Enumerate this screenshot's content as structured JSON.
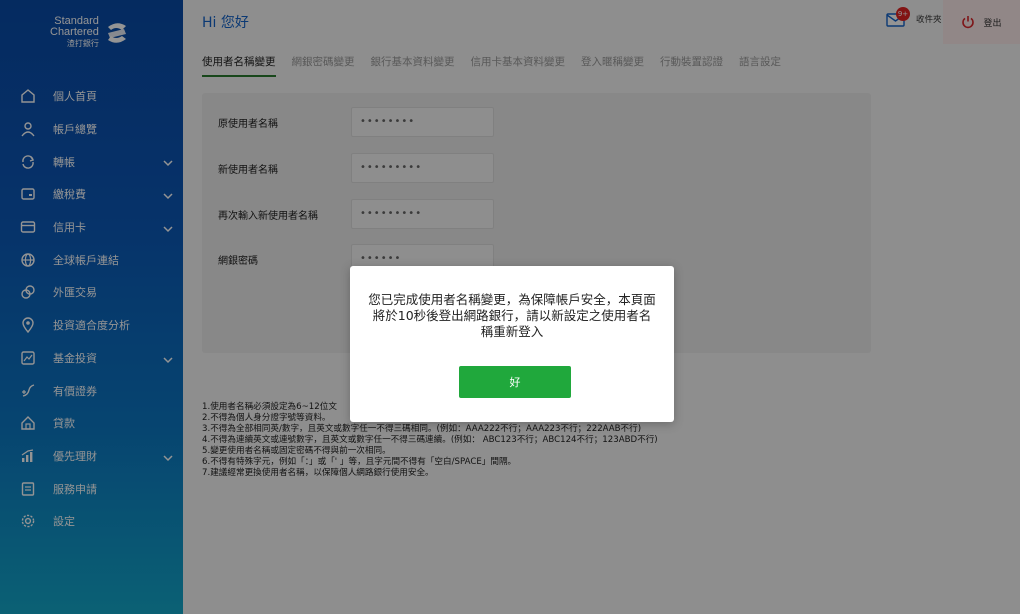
{
  "brand": {
    "line1": "Standard",
    "line2": "Chartered",
    "line3": "渣打銀行"
  },
  "sidebar": {
    "items": [
      {
        "label": "個人首頁",
        "icon": "home-icon",
        "expandable": false
      },
      {
        "label": "帳戶總覽",
        "icon": "user-icon",
        "expandable": false
      },
      {
        "label": "轉帳",
        "icon": "transfer-icon",
        "expandable": true
      },
      {
        "label": "繳稅費",
        "icon": "bill-icon",
        "expandable": true
      },
      {
        "label": "信用卡",
        "icon": "credit-card-icon",
        "expandable": true
      },
      {
        "label": "全球帳戶連結",
        "icon": "globe-icon",
        "expandable": false
      },
      {
        "label": "外匯交易",
        "icon": "currency-icon",
        "expandable": false
      },
      {
        "label": "投資適合度分析",
        "icon": "location-icon",
        "expandable": false
      },
      {
        "label": "基金投資",
        "icon": "fund-icon",
        "expandable": true
      },
      {
        "label": "有價證券",
        "icon": "securities-icon",
        "expandable": false
      },
      {
        "label": "貸款",
        "icon": "loan-icon",
        "expandable": false
      },
      {
        "label": "優先理財",
        "icon": "priority-icon",
        "expandable": true
      },
      {
        "label": "服務申請",
        "icon": "service-icon",
        "expandable": false
      },
      {
        "label": "設定",
        "icon": "settings-icon",
        "expandable": false
      }
    ]
  },
  "header": {
    "greeting": "Hi 您好",
    "mailbox_label": "收件夾",
    "mailbox_badge": "9+",
    "logout_label": "登出"
  },
  "tabs": [
    {
      "label": "使用者名稱變更",
      "active": true
    },
    {
      "label": "網銀密碼變更",
      "active": false
    },
    {
      "label": "銀行基本資料變更",
      "active": false
    },
    {
      "label": "信用卡基本資料變更",
      "active": false
    },
    {
      "label": "登入暱稱變更",
      "active": false
    },
    {
      "label": "行動裝置認證",
      "active": false
    },
    {
      "label": "語言設定",
      "active": false
    }
  ],
  "form": {
    "old_username": {
      "label": "原使用者名稱",
      "value": "••••••••"
    },
    "new_username": {
      "label": "新使用者名稱",
      "value": "•••••••••"
    },
    "confirm_username": {
      "label": "再次輸入新使用者名稱",
      "value": "•••••••••"
    },
    "password": {
      "label": "網銀密碼",
      "value": "••••••"
    }
  },
  "notes": [
    "1.使用者名稱必須設定為6~12位文",
    "2.不得為個人身分證字號等資料。",
    "3.不得為全部相同英/數字，且英文或數字任一不得三碼相同。(例如：AAA222不行；AAA223不行；222AAB不行)",
    "4.不得為連續英文或連號數字，且英文或數字任一不得三碼連續。(例如： ABC123不行；ABC124不行；123ABD不行)",
    "5.變更使用者名稱或固定密碼不得與前一次相同。",
    "6.不得有特殊字元，例如「：」或「'  」等，且字元間不得有「空白/SPACE」間隔。",
    "7.建議經常更換使用者名稱，以保障個人網路銀行使用安全。"
  ],
  "modal": {
    "message": "您已完成使用者名稱變更，為保障帳戶安全，本頁面將於10秒後登出網路銀行，請以新設定之使用者名稱重新登入",
    "ok_label": "好"
  },
  "colors": {
    "accent_blue": "#1463c8",
    "ok_green": "#20a83c",
    "tab_underline": "#2a7a2f",
    "badge_red": "#e02424",
    "logout_bg": "#fae8e8"
  }
}
